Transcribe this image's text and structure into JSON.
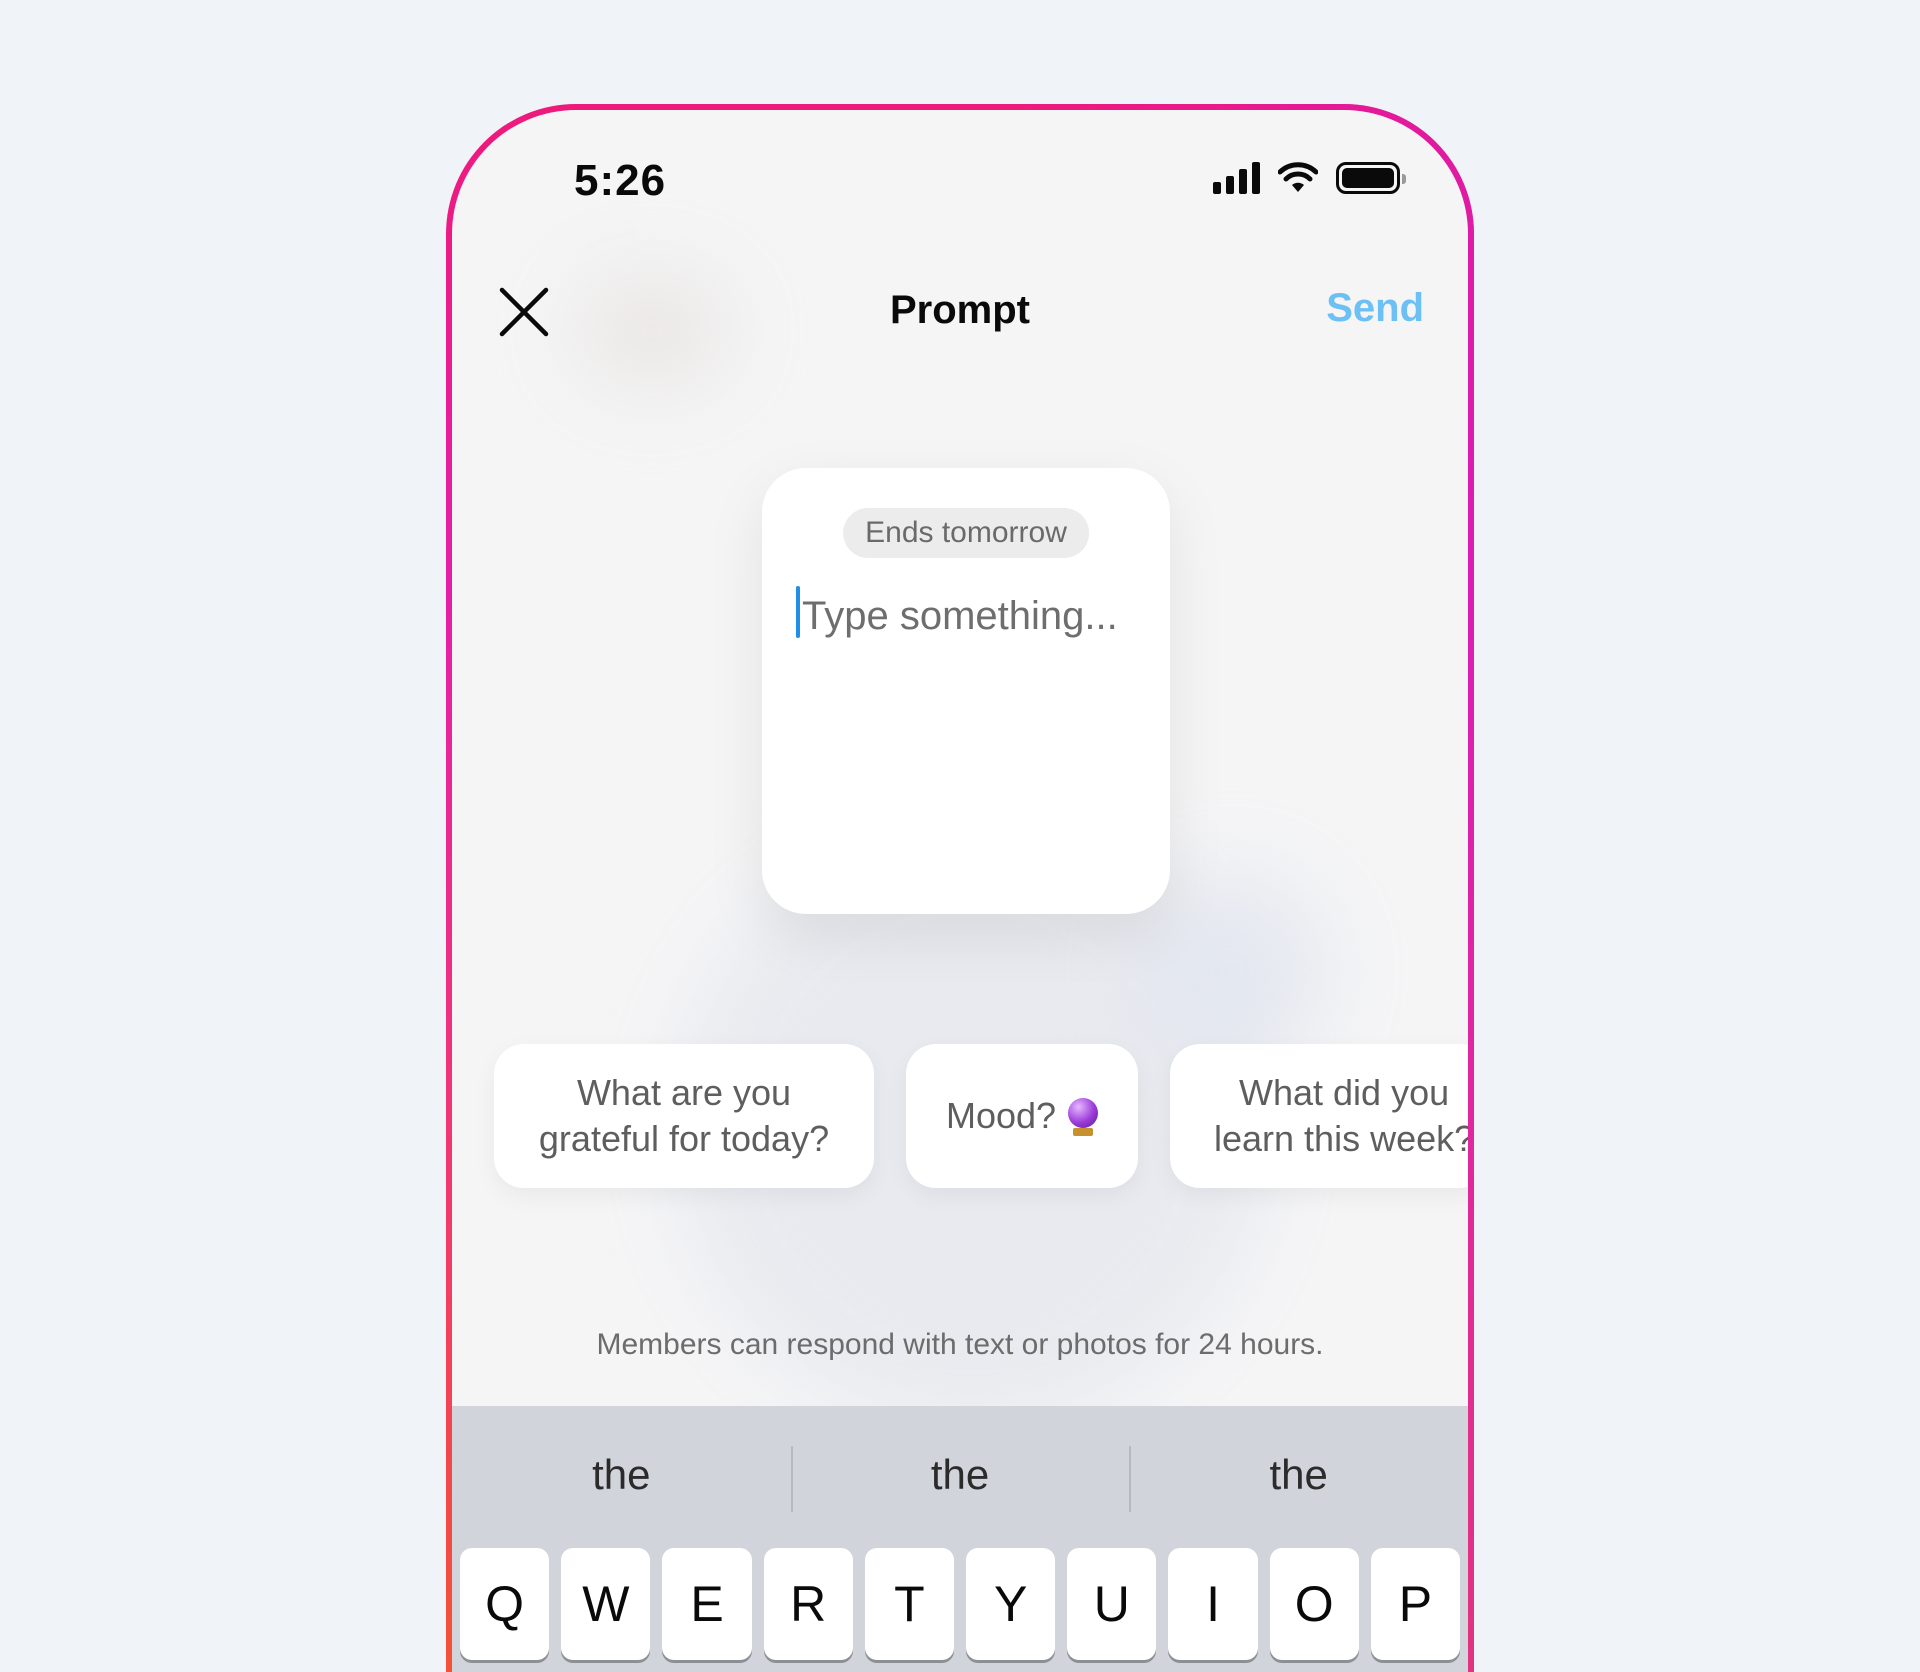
{
  "status_bar": {
    "time": "5:26"
  },
  "nav": {
    "title": "Prompt",
    "send_label": "Send"
  },
  "prompt_card": {
    "badge": "Ends tomorrow",
    "placeholder": "Type something..."
  },
  "suggestions": [
    {
      "label": "What are you\ngrateful for today?"
    },
    {
      "label": "Mood?"
    },
    {
      "label": "What did you\nlearn this week?"
    }
  ],
  "helper_text": "Members can respond with text or photos for 24 hours.",
  "keyboard": {
    "predictions": [
      "the",
      "the",
      "the"
    ],
    "keys": [
      "Q",
      "W",
      "E",
      "R",
      "T",
      "Y",
      "U",
      "I",
      "O",
      "P"
    ]
  },
  "colors": {
    "accent": "#6cc0f3",
    "caret": "#1e8fe9",
    "frame_top": "#ee1a7a",
    "frame_bottom": "#f4542f"
  },
  "icons": [
    "close-icon",
    "signal-icon",
    "wifi-icon",
    "battery-icon",
    "crystal-ball-icon"
  ]
}
